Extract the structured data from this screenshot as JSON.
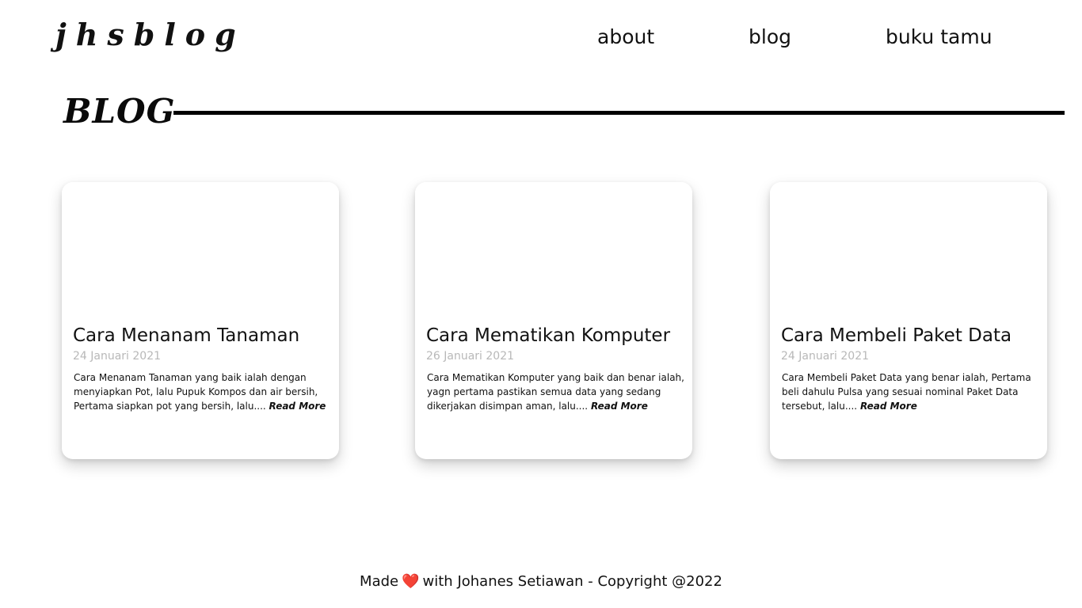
{
  "header": {
    "logo": "jhsblog",
    "nav": [
      {
        "label": "about"
      },
      {
        "label": "blog"
      },
      {
        "label": "buku tamu"
      }
    ]
  },
  "section": {
    "title": "BLOG"
  },
  "posts": [
    {
      "title": "Cara Menanam Tanaman",
      "date": "24 Januari 2021",
      "excerpt": "Cara Menanam Tanaman yang baik ialah dengan menyiapkan Pot, lalu Pupuk Kompos dan air bersih, Pertama siapkan pot yang bersih, lalu....",
      "read_more": "Read More"
    },
    {
      "title": "Cara Mematikan Komputer",
      "date": "26 Januari 2021",
      "excerpt": "Cara Mematikan Komputer yang baik dan benar ialah, yagn pertama pastikan semua data yang sedang dikerjakan disimpan aman, lalu....",
      "read_more": "Read More"
    },
    {
      "title": "Cara Membeli Paket Data",
      "date": "24 Januari 2021",
      "excerpt": "Cara Membeli Paket Data yang benar ialah, Pertama beli dahulu Pulsa yang sesuai nominal Paket Data tersebut, lalu....",
      "read_more": "Read More"
    }
  ],
  "footer": {
    "prefix": "Made",
    "heart_icon": "❤️",
    "suffix": "with Johanes Setiawan - Copyright @2022",
    "colors": {
      "heart": "#e02424"
    }
  }
}
